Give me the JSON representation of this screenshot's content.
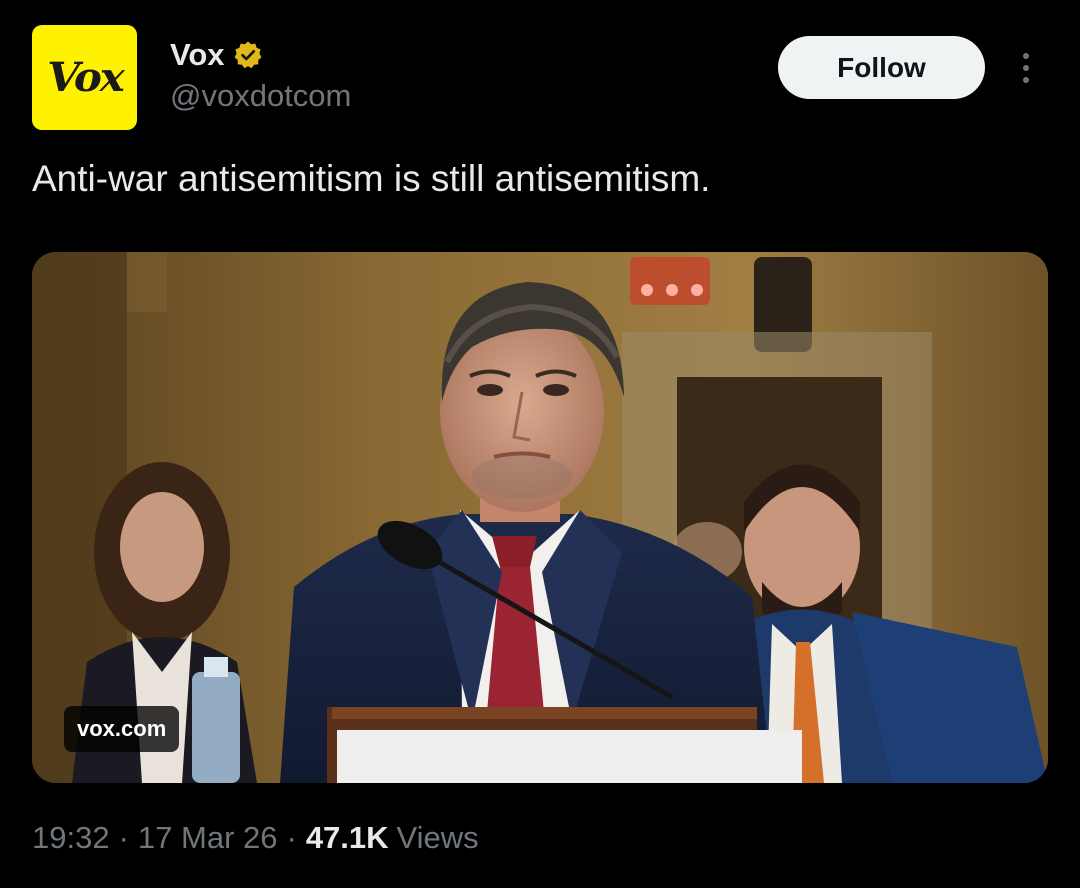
{
  "author": {
    "avatar_logo_text": "Vox",
    "display_name": "Vox",
    "handle": "@voxdotcom",
    "verified_badge_color": "#e2b719"
  },
  "actions": {
    "follow_label": "Follow",
    "more_icon": "more-vertical-icon"
  },
  "post": {
    "text": "Anti-war antisemitism is still antisemitism.",
    "media": {
      "link_domain": "vox.com"
    },
    "time": "19:32",
    "separator": "·",
    "date": "17 Mar 26",
    "views_count": "47.1K",
    "views_label": "Views"
  },
  "colors": {
    "background": "#000000",
    "primary_text": "#e7e9ea",
    "secondary_text": "#71767b",
    "avatar_bg": "#fff200",
    "follow_bg": "#eff3f4"
  }
}
